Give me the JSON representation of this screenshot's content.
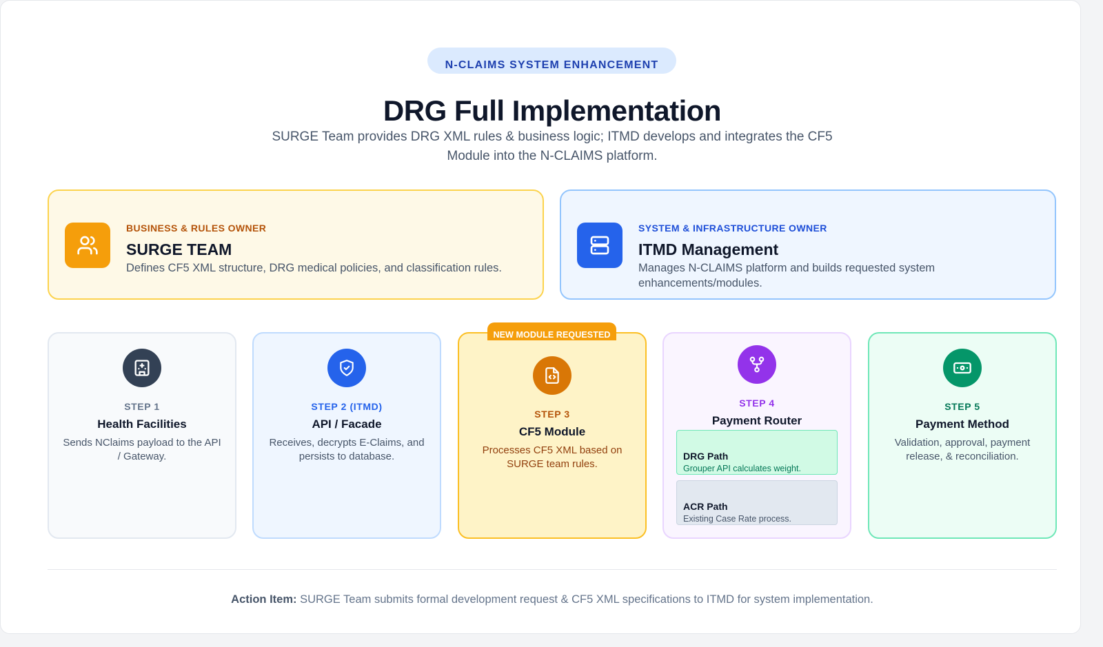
{
  "header": {
    "badge": "N-CLAIMS SYSTEM ENHANCEMENT",
    "title": "DRG Full Implementation",
    "subtitle": "SURGE Team provides DRG XML rules & business logic; ITMD develops and integrates the CF5 Module into the N-CLAIMS platform."
  },
  "owners": [
    {
      "kicker": "BUSINESS & RULES OWNER",
      "name": "SURGE TEAM",
      "desc": "Defines CF5 XML structure, DRG medical policies, and classification rules.",
      "icon": "users-icon",
      "color": "#f59e0b"
    },
    {
      "kicker": "SYSTEM & INFRASTRUCTURE OWNER",
      "name": "ITMD Management",
      "desc": "Manages N-CLAIMS platform and builds requested system enhancements/modules.",
      "icon": "server-icon",
      "color": "#2563eb"
    }
  ],
  "steps": [
    {
      "label": "STEP 1",
      "name": "Health Facilities",
      "desc": "Sends NClaims payload to the API / Gateway.",
      "icon": "hospital-icon",
      "color": "#334155"
    },
    {
      "label": "STEP 2 (ITMD)",
      "name": "API / Facade",
      "desc": "Receives, decrypts E-Claims, and persists to database.",
      "icon": "shield-check-icon",
      "color": "#2563eb"
    },
    {
      "label": "STEP 3",
      "name": "CF5 Module",
      "desc": "Processes CF5 XML based on SURGE team rules.",
      "icon": "file-code-icon",
      "color": "#d97706",
      "tag": "NEW MODULE REQUESTED"
    },
    {
      "label": "STEP 4",
      "name": "Payment Router",
      "icon": "git-fork-icon",
      "color": "#9333ea",
      "paths": [
        {
          "name": "DRG Path",
          "desc": "Grouper API calculates weight."
        },
        {
          "name": "ACR Path",
          "desc": "Existing Case Rate process."
        }
      ]
    },
    {
      "label": "STEP 5",
      "name": "Payment Method",
      "desc": "Validation, approval, payment release, & reconciliation.",
      "icon": "banknote-icon",
      "color": "#059669"
    }
  ],
  "footer": {
    "action_label": "Action Item:",
    "action_text": "SURGE Team submits formal development request & CF5 XML specifications to ITMD for system implementation."
  }
}
